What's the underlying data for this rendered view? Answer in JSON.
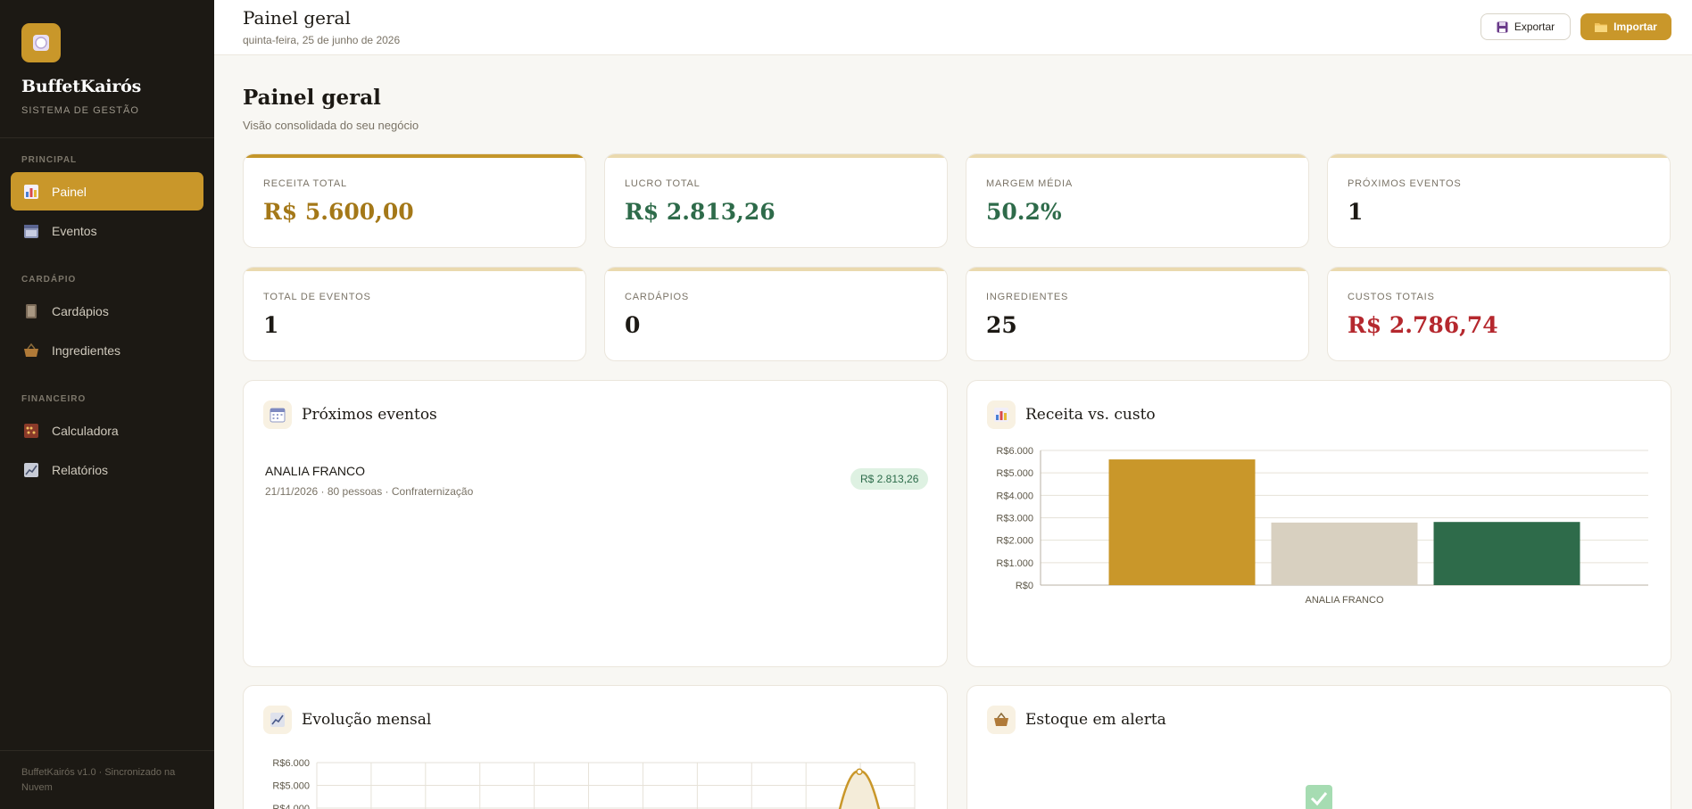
{
  "sidebar": {
    "brand": "BuffetKairós",
    "subtitle": "SISTEMA DE GESTÃO",
    "sections": [
      {
        "label": "PRINCIPAL",
        "items": [
          {
            "label": "Painel",
            "icon": "bar-chart-icon"
          },
          {
            "label": "Eventos",
            "icon": "calendar-icon"
          }
        ]
      },
      {
        "label": "CARDÁPIO",
        "items": [
          {
            "label": "Cardápios",
            "icon": "book-icon"
          },
          {
            "label": "Ingredientes",
            "icon": "basket-icon"
          }
        ]
      },
      {
        "label": "FINANCEIRO",
        "items": [
          {
            "label": "Calculadora",
            "icon": "abacus-icon"
          },
          {
            "label": "Relatórios",
            "icon": "chart-up-icon"
          }
        ]
      }
    ],
    "footer": "BuffetKairós v1.0 · Sincronizado na Nuvem"
  },
  "topbar": {
    "title": "Painel geral",
    "date": "quinta-feira, 25 de junho de 2026",
    "export_label": "Exportar",
    "import_label": "Importar"
  },
  "main": {
    "title": "Painel geral",
    "subtitle": "Visão consolidada do seu negócio"
  },
  "stats": [
    {
      "label": "RECEITA TOTAL",
      "value": "R$ 5.600,00",
      "color": "#a47818"
    },
    {
      "label": "LUCRO TOTAL",
      "value": "R$ 2.813,26",
      "color": "#2e6b4a"
    },
    {
      "label": "MARGEM MÉDIA",
      "value": "50.2%",
      "color": "#2e6b4a"
    },
    {
      "label": "PRÓXIMOS EVENTOS",
      "value": "1",
      "color": "#1c1914"
    },
    {
      "label": "TOTAL DE EVENTOS",
      "value": "1",
      "color": "#1c1914"
    },
    {
      "label": "CARDÁPIOS",
      "value": "0",
      "color": "#1c1914"
    },
    {
      "label": "INGREDIENTES",
      "value": "25",
      "color": "#1c1914"
    },
    {
      "label": "CUSTOS TOTAIS",
      "value": "R$ 2.786,74",
      "color": "#b5282e"
    }
  ],
  "upcoming": {
    "title": "Próximos eventos",
    "events": [
      {
        "name": "ANALIA FRANCO",
        "meta": "21/11/2026 · 80 pessoas · Confraternização",
        "badge": "R$ 2.813,26"
      }
    ]
  },
  "revenue_chart": {
    "title": "Receita vs. custo"
  },
  "monthly_chart": {
    "title": "Evolução mensal"
  },
  "stock": {
    "title": "Estoque em alerta"
  },
  "colors": {
    "accent": "#c9972a",
    "sidebar": "#1c1914",
    "profit": "#2e6b4a",
    "cost": "#d8d0c0",
    "danger": "#b5282e"
  },
  "chart_data": [
    {
      "type": "bar",
      "categories": [
        "ANALIA FRANCO"
      ],
      "series": [
        {
          "values": [
            5600
          ],
          "color": "#c9972a"
        },
        {
          "values": [
            2786.74
          ],
          "color": "#d8d0c0"
        },
        {
          "values": [
            2813.26
          ],
          "color": "#2e6b4a"
        }
      ],
      "ylim": [
        0,
        6000
      ],
      "yticks": [
        "R$0",
        "R$1.000",
        "R$2.000",
        "R$3.000",
        "R$4.000",
        "R$5.000",
        "R$6.000"
      ],
      "grid": true
    },
    {
      "type": "line",
      "yticks_visible": [
        "R$6.000",
        "R$5.000",
        "R$4.000"
      ],
      "ylim": [
        0,
        6000
      ],
      "series": [
        {
          "peak_value": 5600,
          "color": "#c9972a"
        }
      ],
      "grid": true
    }
  ]
}
